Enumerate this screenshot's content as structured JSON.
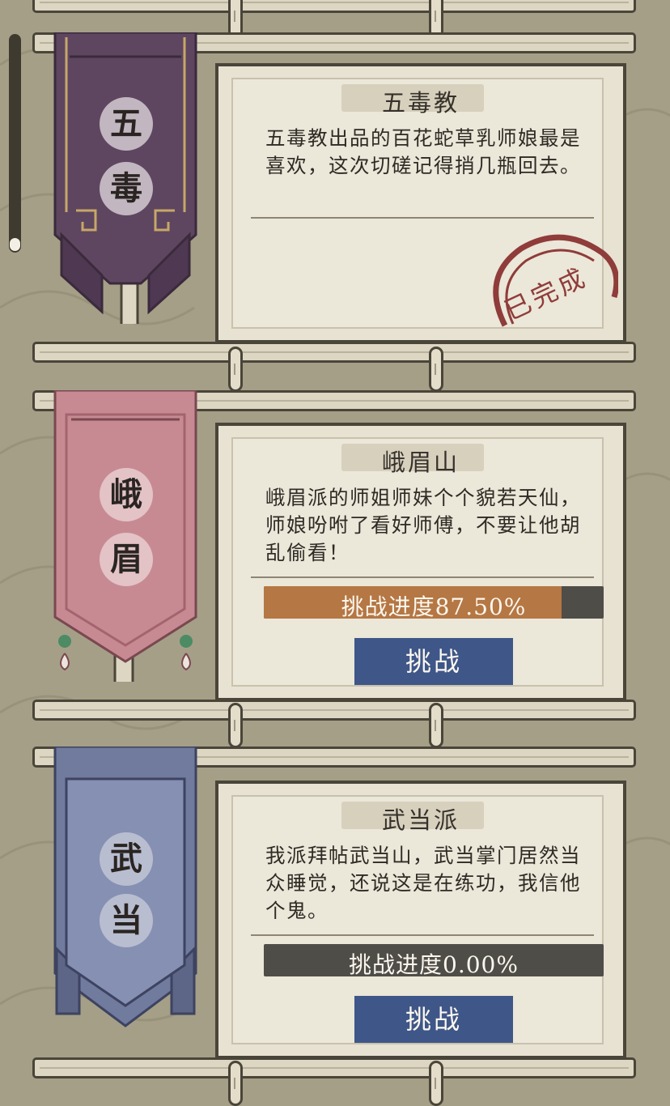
{
  "scrollbar": {
    "progress": 0.0
  },
  "sects": [
    {
      "banner_glyphs": [
        "五",
        "毒"
      ],
      "title": "五毒教",
      "desc": "五毒教出品的百花蛇草乳师娘最是喜欢，这次切磋记得捎几瓶回去。",
      "status": "已完成"
    },
    {
      "banner_glyphs": [
        "峨",
        "眉"
      ],
      "title": "峨眉山",
      "desc": "峨眉派的师姐师妹个个貌若天仙，师娘吩咐了看好师傅，不要让他胡乱偷看！",
      "progress_label": "挑战进度87.50%",
      "progress_value": 87.5,
      "button_label": "挑战"
    },
    {
      "banner_glyphs": [
        "武",
        "当"
      ],
      "title": "武当派",
      "desc": "我派拜帖武当山，武当掌门居然当众睡觉，还说这是在练功，我信他个鬼。",
      "progress_label": "挑战进度0.00%",
      "progress_value": 0.0,
      "button_label": "挑战"
    }
  ],
  "colors": {
    "background": "#a59f87",
    "banner_wudu": "#5e4660",
    "banner_emei": "#c78a93",
    "banner_wudang": "#707b9e",
    "progress_fill": "#b57744",
    "button": "#3f5688",
    "stamp": "#8f3c3a"
  }
}
